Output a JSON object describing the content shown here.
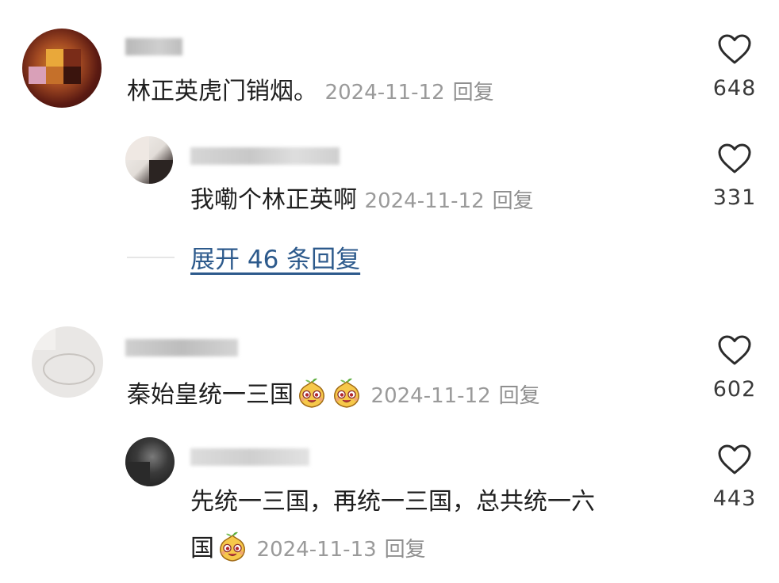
{
  "comments": [
    {
      "text": "林正英虎门销烟。",
      "date": "2024-11-12",
      "reply_label": "回复",
      "likes": "648",
      "replies": [
        {
          "text": "我嘞个林正英啊",
          "date": "2024-11-12",
          "reply_label": "回复",
          "likes": "331"
        }
      ],
      "expand_label": "展开 46 条回复"
    },
    {
      "text": "秦始皇统一三国",
      "date": "2024-11-12",
      "reply_label": "回复",
      "likes": "602",
      "replies": [
        {
          "text_line1": "先统一三国，再统一三国，总共统一六",
          "text_line2": "国",
          "date": "2024-11-13",
          "reply_label": "回复",
          "likes": "443"
        }
      ]
    }
  ],
  "icons": {
    "like": "heart-outline-icon",
    "emoji": "pear-face-emoji"
  },
  "colors": {
    "link": "#2d5a8c",
    "meta": "#9a9a9a",
    "text": "#1f1f1f"
  }
}
